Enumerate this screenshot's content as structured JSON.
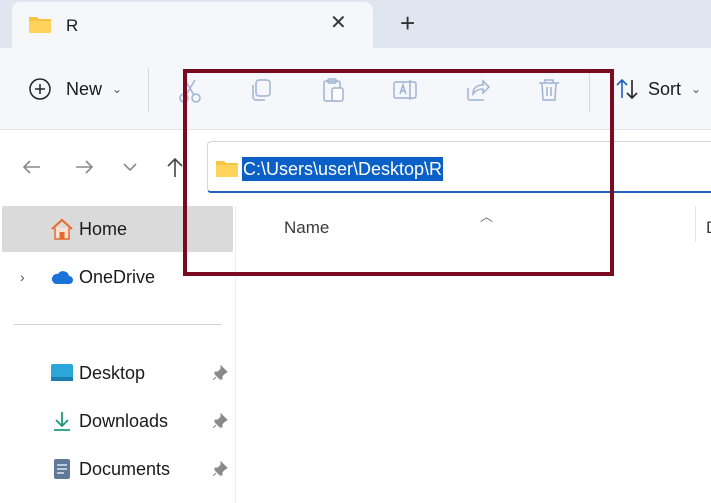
{
  "tab": {
    "title": "R",
    "close_icon": "close-icon",
    "add_icon": "plus-icon"
  },
  "toolbar": {
    "new_label": "New",
    "sort_label": "Sort",
    "tools": [
      "cut-icon",
      "copy-icon",
      "paste-icon",
      "rename-icon",
      "share-icon",
      "delete-icon"
    ]
  },
  "address": {
    "path": "C:\\Users\\user\\Desktop\\R"
  },
  "sidebar": {
    "items": [
      {
        "label": "Home",
        "icon": "home-icon",
        "selected": true
      },
      {
        "label": "OneDrive",
        "icon": "cloud-icon",
        "expandable": true
      },
      {
        "label": "Desktop",
        "icon": "desktop-icon",
        "pinned": true
      },
      {
        "label": "Downloads",
        "icon": "download-icon",
        "pinned": true
      },
      {
        "label": "Documents",
        "icon": "documents-icon",
        "pinned": true
      }
    ]
  },
  "content": {
    "column_name": "Name",
    "column_next_partial": "D"
  },
  "colors": {
    "accent": "#0a60c6",
    "highlight_border": "#7a0a20",
    "folder": "#f4c542"
  }
}
